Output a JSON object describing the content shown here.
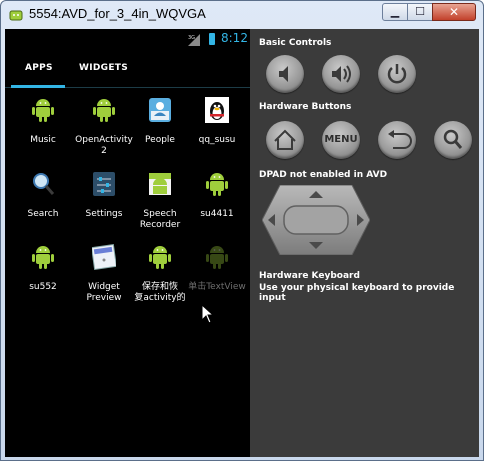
{
  "window": {
    "title": "5554:AVD_for_3_4in_WQVGA",
    "min_label": "▁",
    "max_label": "☐",
    "close_label": "✕"
  },
  "statusbar": {
    "signal": "3G",
    "time": "8:12"
  },
  "launcher": {
    "tabs": [
      {
        "label": "APPS"
      },
      {
        "label": "WIDGETS"
      }
    ],
    "apps": [
      {
        "label": "Music",
        "icon": "android-icon"
      },
      {
        "label": "OpenActivity\n2",
        "icon": "android-icon"
      },
      {
        "label": "People",
        "icon": "people-icon"
      },
      {
        "label": "qq_susu",
        "icon": "penguin-icon"
      },
      {
        "label": "Search",
        "icon": "search-icon"
      },
      {
        "label": "Settings",
        "icon": "settings-icon"
      },
      {
        "label": "Speech\nRecorder",
        "icon": "speech-recorder-icon"
      },
      {
        "label": "su4411",
        "icon": "android-icon"
      },
      {
        "label": "su552",
        "icon": "android-icon"
      },
      {
        "label": "Widget\nPreview",
        "icon": "widget-preview-icon"
      },
      {
        "label": "保存和恢\n复activity的",
        "icon": "android-icon"
      },
      {
        "label": "单击TextView",
        "icon": "android-icon"
      }
    ]
  },
  "controls": {
    "basic_title": "Basic Controls",
    "hardware_title": "Hardware Buttons",
    "menu_label": "MENU",
    "dpad_title": "DPAD not enabled in AVD",
    "keyboard_title": "Hardware Keyboard",
    "keyboard_sub": "Use your physical keyboard to provide input"
  },
  "colors": {
    "accent": "#33b5e5",
    "android_green": "#9fce3c",
    "panel": "#3b3b3b"
  }
}
